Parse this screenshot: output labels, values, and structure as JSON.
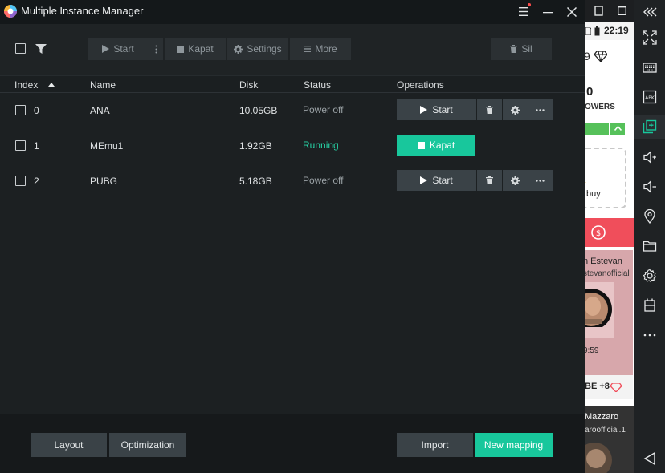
{
  "window": {
    "title": "Multiple Instance Manager"
  },
  "toolbar": {
    "start_label": "Start",
    "kapat_label": "Kapat",
    "settings_label": "Settings",
    "more_label": "More",
    "sil_label": "Sil"
  },
  "table": {
    "headers": {
      "index": "Index",
      "name": "Name",
      "disk": "Disk",
      "status": "Status",
      "operations": "Operations"
    },
    "rows": [
      {
        "index": "0",
        "name": "ANA",
        "disk": "10.05GB",
        "status": "Power off",
        "action": "Start"
      },
      {
        "index": "1",
        "name": "MEmu1",
        "disk": "1.92GB",
        "status": "Running",
        "action": "Kapat"
      },
      {
        "index": "2",
        "name": "PUBG",
        "disk": "5.18GB",
        "status": "Power off",
        "action": "Start"
      }
    ]
  },
  "footer": {
    "layout_label": "Layout",
    "optimization_label": "Optimization",
    "import_label": "Import",
    "new_mapping_label": "New mapping"
  },
  "emulator": {
    "clock": "22:19",
    "battery_count": "9",
    "followers_count": "0",
    "followers_label": "OWERS",
    "buy_label": "buy",
    "card1_name": "n Estevan",
    "card1_handle": "stevanofficial",
    "card1_time": "9:59",
    "card1_badge": "BE +8",
    "card2_name": "Mazzaro",
    "card2_handle": "aroofficial.1"
  },
  "colors": {
    "accent": "#18c79c",
    "running": "#27d3a6",
    "emu_red": "#f04e5b"
  }
}
